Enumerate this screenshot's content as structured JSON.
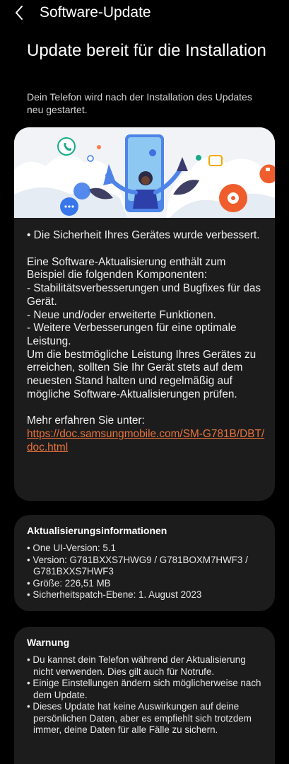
{
  "topbar": {
    "title": "Software-Update",
    "back_icon": "chevron-left-icon"
  },
  "heading": "Update bereit für die Installation",
  "subtitle": "Dein Telefon wird nach der Installation des Updates neu gestartet.",
  "release_notes": {
    "security": "• Die Sicherheit Ihres Gerätes wurde verbessert.",
    "intro": "Eine Software-Aktualisierung enthält zum Beispiel die folgenden Komponenten:",
    "items": [
      " - Stabilitätsverbesserungen und Bugfixes für das Gerät.",
      " - Neue und/oder erweiterte Funktionen.",
      " - Weitere Verbesserungen für eine optimale Leistung."
    ],
    "advice": "Um die bestmögliche Leistung Ihres Gerätes zu erreichen, sollten Sie Ihr Gerät stets auf dem neuesten Stand halten und regelmäßig auf mögliche Software-Aktualisierungen prüfen.",
    "more_label": "Mehr erfahren Sie unter:",
    "link": "https://doc.samsungmobile.com/SM-G781B/DBT/doc.html"
  },
  "update_info": {
    "title": "Aktualisierungsinformationen",
    "items": [
      "• One UI-Version: 5.1",
      "• Version: G781BXXS7HWG9 / G781BOXM7HWF3 / G781BXXS7HWF3",
      "• Größe: 226,51 MB",
      "• Sicherheitspatch-Ebene: 1. August 2023"
    ]
  },
  "warning": {
    "title": "Warnung",
    "items": [
      "• Du kannst dein Telefon während der Aktualisierung nicht verwenden. Dies gilt auch für Notrufe.",
      "• Einige Einstellungen ändern sich möglicherweise nach dem Update.",
      "• Dieses Update hat keine Auswirkungen auf deine persönlichen Daten, aber es empfiehlt sich trotzdem immer, deine Daten für alle Fälle zu sichern."
    ]
  },
  "colors": {
    "background": "#000000",
    "card": "#1c1c1c",
    "link": "#e8733c",
    "banner": "#f1f3f6"
  }
}
